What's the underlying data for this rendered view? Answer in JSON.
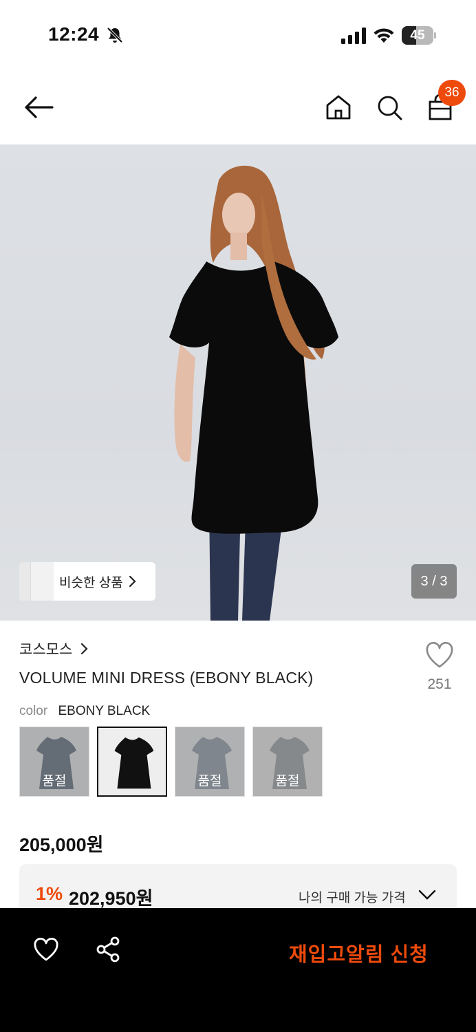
{
  "status_bar": {
    "time": "12:24",
    "battery_level": "45",
    "battery_fraction": 0.45,
    "icons": [
      "bell-slash-icon",
      "cellular-signal-icon",
      "wifi-icon",
      "battery-icon"
    ]
  },
  "nav": {
    "cart_count": "36",
    "icons": [
      "back-arrow-icon",
      "home-icon",
      "search-icon",
      "shopping-bag-icon"
    ],
    "badge_color": "#ee4a0c"
  },
  "gallery": {
    "similar_label": "비슷한 상품",
    "counter": "3 / 3"
  },
  "product": {
    "brand": "코스모스",
    "name": "VOLUME MINI DRESS (EBONY BLACK)",
    "like_count": "251",
    "color_label": "color",
    "color_value": "EBONY BLACK",
    "swatches": [
      {
        "status": "품절",
        "tone": "#5b6a7b"
      },
      {
        "status": "",
        "tone": "#111111"
      },
      {
        "status": "품절",
        "tone": "#8d9aa6"
      },
      {
        "status": "품절",
        "tone": "#9a9ea3"
      }
    ],
    "price": "205,000원"
  },
  "benefit": {
    "discount": "1%",
    "price": "202,950원",
    "label": "나의 구매 가능 가격"
  },
  "bottom_bar": {
    "cta": "재입고알림 신청",
    "accent_color": "#ee4a0c"
  }
}
